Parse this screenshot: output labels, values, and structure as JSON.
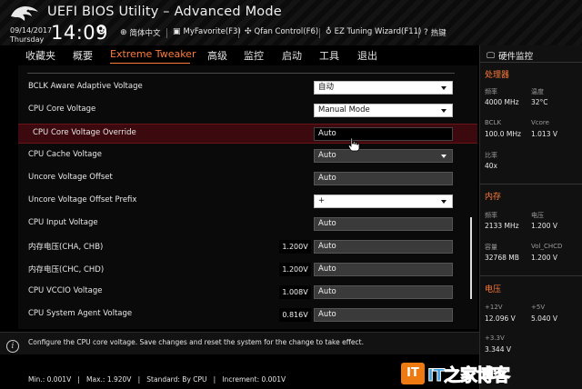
{
  "header": {
    "title": "UEFI BIOS Utility – Advanced Mode",
    "date": "09/14/2017",
    "day": "Thursday",
    "time": "14:09",
    "items": [
      {
        "label": "简体中文",
        "icon": "globe-icon"
      },
      {
        "label": "MyFavorite(F3)",
        "icon": "favorite-icon"
      },
      {
        "label": "Qfan Control(F6)",
        "icon": "fan-icon"
      },
      {
        "label": "EZ Tuning Wizard(F11)",
        "icon": "bulb-icon"
      },
      {
        "label": "热键",
        "icon": "hotkey-icon"
      }
    ]
  },
  "nav": {
    "tabs": [
      "收藏夹",
      "概要",
      "Extreme Tweaker",
      "高级",
      "监控",
      "启动",
      "工具",
      "退出"
    ],
    "active": "Extreme Tweaker"
  },
  "rows": [
    {
      "label": "BCLK Aware Adaptive Voltage",
      "value": "自动",
      "kind": "dropdown"
    },
    {
      "label": "CPU Core Voltage",
      "value": "Manual Mode",
      "kind": "dropdown"
    },
    {
      "label": "CPU Core Voltage Override",
      "value": "Auto",
      "kind": "input-selected"
    },
    {
      "label": "CPU Cache Voltage",
      "value": "Auto",
      "kind": "dropdown-dark"
    },
    {
      "label": "Uncore Voltage Offset",
      "value": "Auto",
      "kind": "input"
    },
    {
      "label": "Uncore Voltage Offset Prefix",
      "value": "+",
      "kind": "dropdown"
    },
    {
      "label": "CPU Input Voltage",
      "value": "Auto",
      "kind": "input"
    },
    {
      "label": "内存电压(CHA, CHB)",
      "value": "Auto",
      "kind": "input",
      "volt": "1.200V"
    },
    {
      "label": "内存电压(CHC, CHD)",
      "value": "Auto",
      "kind": "input",
      "volt": "1.200V"
    },
    {
      "label": "CPU VCCIO Voltage",
      "value": "Auto",
      "kind": "input",
      "volt": "1.008V"
    },
    {
      "label": "CPU System Agent Voltage",
      "value": "Auto",
      "kind": "input",
      "volt": "0.816V"
    }
  ],
  "info": {
    "text": "Configure the CPU core voltage. Save changes and reset the system for the change to take effect.",
    "specs": "Min.: 0.001V   |   Max.: 1.920V   |   Standard: By CPU   |   Increment: 0.001V"
  },
  "monitor": {
    "title": "硬件监控",
    "processor": {
      "heading": "处理器",
      "freq_label": "频率",
      "freq": "4000 MHz",
      "temp_label": "温度",
      "temp": "32°C",
      "bclk_label": "BCLK",
      "bclk": "100.0 MHz",
      "vcore_label": "Vcore",
      "vcore": "1.013 V",
      "ratio_label": "比率",
      "ratio": "40x"
    },
    "memory": {
      "heading": "内存",
      "freq_label": "频率",
      "freq": "2133 MHz",
      "volt_label": "电压",
      "volt": "1.200 V",
      "cap_label": "容量",
      "cap": "32768 MB",
      "chcd_label": "Vol_CHCD",
      "chcd": "1.200 V"
    },
    "voltage": {
      "heading": "电压",
      "v12_label": "+12V",
      "v12": "12.096 V",
      "v5_label": "+5V",
      "v5": "5.040 V",
      "v33_label": "+3.3V",
      "v33": "3.344 V"
    }
  },
  "watermark": {
    "logo": "IT",
    "text": "IT之家博客"
  },
  "colors": {
    "accent": "#ff7b3a",
    "selected_row": "#3c0a0e",
    "background": "#000000"
  }
}
